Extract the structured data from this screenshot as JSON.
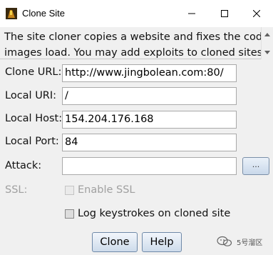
{
  "window": {
    "title": "Clone Site",
    "icons": {
      "app": "app-icon",
      "minimize": "minimize-icon",
      "maximize": "maximize-icon",
      "close": "close-icon"
    }
  },
  "description": {
    "line1": "The site cloner copies a website and fixes the code so",
    "line2": "images load. You may add exploits to cloned sites or"
  },
  "form": {
    "clone_url": {
      "label": "Clone URL:",
      "value": "http://www.jingbolean.com:80/"
    },
    "local_uri": {
      "label": "Local URI:",
      "value": "/"
    },
    "local_host": {
      "label": "Local Host:",
      "value": "154.204.176.168"
    },
    "local_port": {
      "label": "Local Port:",
      "value": "84"
    },
    "attack": {
      "label": "Attack:",
      "value": "",
      "browse_label": "..."
    },
    "ssl": {
      "label": "SSL:",
      "checkbox_label": "Enable SSL",
      "checked": false,
      "enabled": false
    },
    "log_keystrokes": {
      "label": "Log keystrokes on cloned site",
      "checked": false
    }
  },
  "buttons": {
    "clone": "Clone",
    "help": "Help"
  },
  "watermark": {
    "text": "5号溜区"
  }
}
